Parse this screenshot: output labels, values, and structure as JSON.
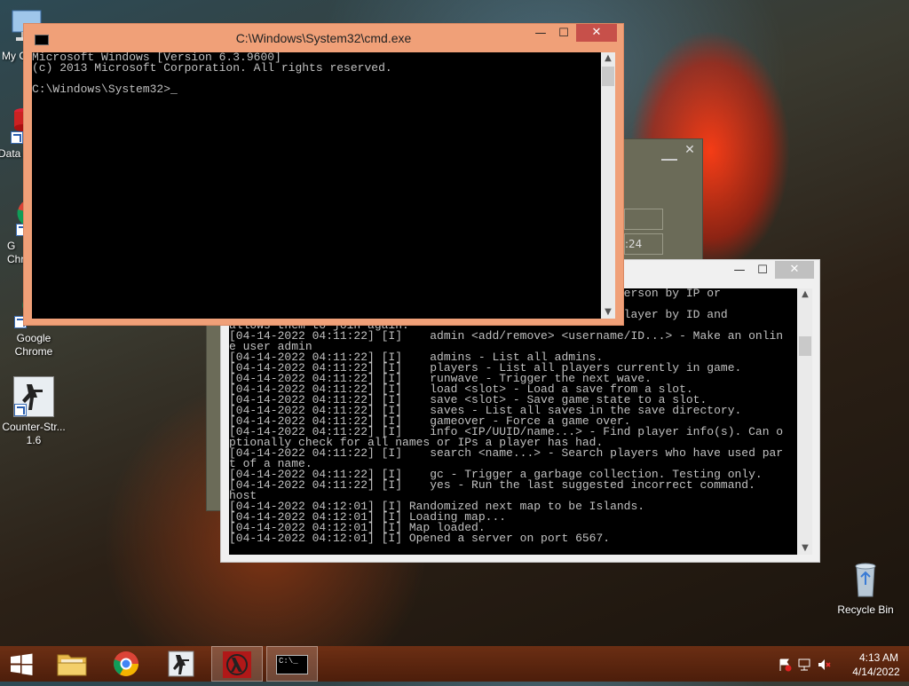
{
  "desktop": {
    "icons": [
      {
        "label": "My C"
      },
      {
        "label": "Data"
      },
      {
        "label": "G\nChr"
      },
      {
        "label": "Google\nChrome"
      },
      {
        "label": "Counter-Str...\n1.6"
      },
      {
        "label": "Recycle Bin"
      }
    ]
  },
  "cmd_window": {
    "title": "C:\\Windows\\System32\\cmd.exe",
    "lines": [
      "Microsoft Windows [Version 6.3.9600]",
      "(c) 2013 Microsoft Corporation. All rights reserved.",
      "",
      "C:\\Windows\\System32>_"
    ]
  },
  "server_window": {
    "lines": [
      "                                                unban a person by IP or",
      "",
      "                                                ekicked player by ID and",
      "allows them to join again.",
      "[04-14-2022 04:11:22] [I]    admin <add/remove> <username/ID...> - Make an onlin",
      "e user admin",
      "[04-14-2022 04:11:22] [I]    admins - List all admins.",
      "[04-14-2022 04:11:22] [I]    players - List all players currently in game.",
      "[04-14-2022 04:11:22] [I]    runwave - Trigger the next wave.",
      "[04-14-2022 04:11:22] [I]    load <slot> - Load a save from a slot.",
      "[04-14-2022 04:11:22] [I]    save <slot> - Save game state to a slot.",
      "[04-14-2022 04:11:22] [I]    saves - List all saves in the save directory.",
      "[04-14-2022 04:11:22] [I]    gameover - Force a game over.",
      "[04-14-2022 04:11:22] [I]    info <IP/UUID/name...> - Find player info(s). Can o",
      "ptionally check for all names or IPs a player has had.",
      "[04-14-2022 04:11:22] [I]    search <name...> - Search players who have used par",
      "t of a name.",
      "[04-14-2022 04:11:22] [I]    gc - Trigger a garbage collection. Testing only.",
      "[04-14-2022 04:11:22] [I]    yes - Run the last suggested incorrect command.",
      "host",
      "[04-14-2022 04:12:01] [I] Randomized next map to be Islands.",
      "[04-14-2022 04:12:01] [I] Loading map...",
      "[04-14-2022 04:12:01] [I] Map loaded.",
      "[04-14-2022 04:12:01] [I] Opened a server on port 6567."
    ]
  },
  "background_window": {
    "field_text": ":24"
  },
  "window_controls": {
    "minimize": "—",
    "maximize": "☐",
    "close": "✕"
  },
  "taskbar": {
    "time": "4:13 AM",
    "date": "4/14/2022",
    "cmd_icon_text": "C:\\_"
  },
  "colors": {
    "cmd_frame": "#f0a078",
    "close_red": "#c7504a",
    "console_bg": "#000000",
    "console_text": "#c0c0c0"
  }
}
